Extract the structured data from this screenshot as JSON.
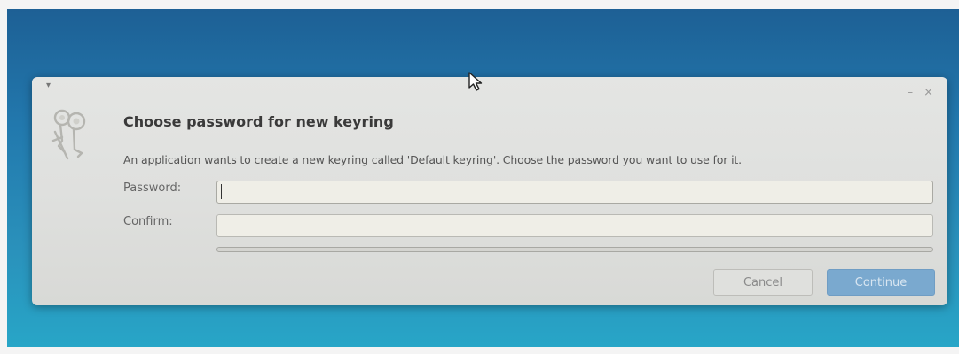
{
  "dialog": {
    "title": "Choose password for new keyring",
    "description": "An application wants to create a new keyring called 'Default keyring'. Choose the password you want to use for it.",
    "password_label": "Password:",
    "password_value": "",
    "confirm_label": "Confirm:",
    "confirm_value": "",
    "strength_fraction": 0,
    "cancel_label": "Cancel",
    "continue_label": "Continue",
    "minimize_label": "–",
    "close_label": "×",
    "menu_label": "▾",
    "icon": "keyring-icon"
  },
  "colors": {
    "accent": "#7aa9cf",
    "desktop": "#2278ad",
    "dialog_bg": "#e0e1df"
  }
}
